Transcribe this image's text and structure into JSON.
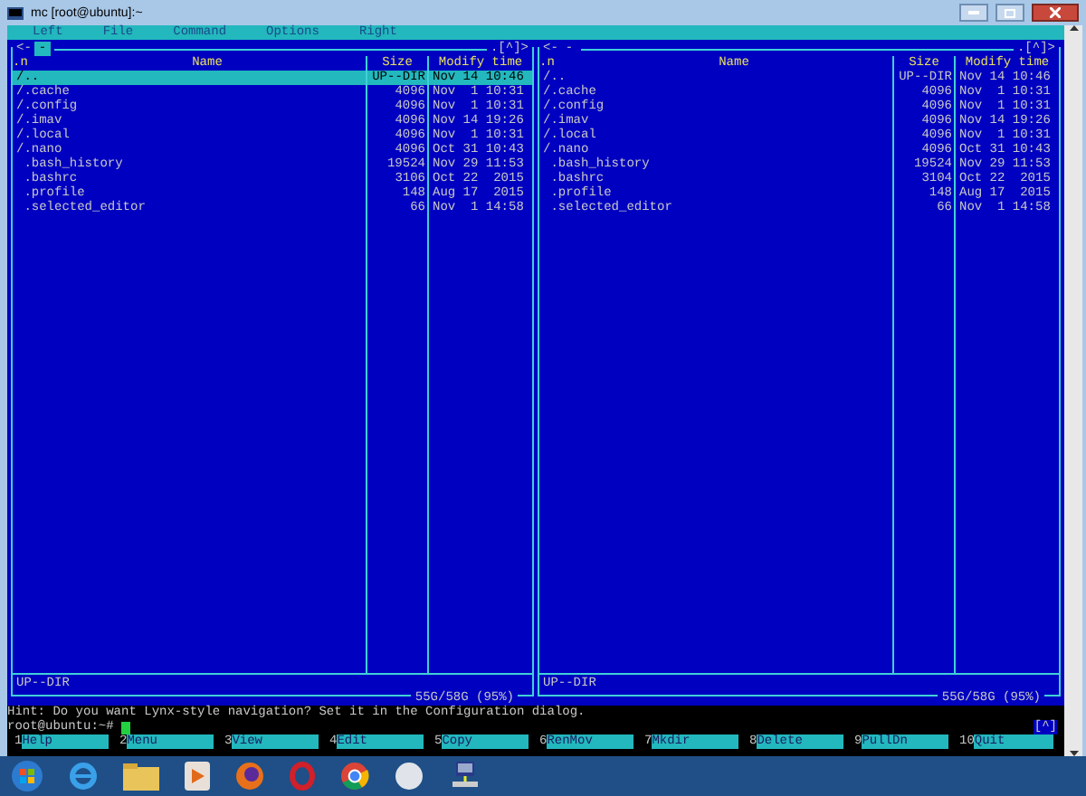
{
  "window": {
    "title": "mc [root@ubuntu]:~"
  },
  "menu_bar": [
    {
      "label": "Left"
    },
    {
      "label": "File"
    },
    {
      "label": "Command"
    },
    {
      "label": "Options"
    },
    {
      "label": "Right"
    }
  ],
  "panels": [
    {
      "active": true,
      "header_left": "<-",
      "header_mark": "-",
      "header_right": ".[^]>",
      "columns": [
        ".n",
        "Name",
        "Size",
        "Modify time"
      ],
      "rows": [
        {
          "name": "/..",
          "size": "UP--DIR",
          "modified": "Nov 14 10:46",
          "selected": true
        },
        {
          "name": "/.cache",
          "size": "4096",
          "modified": "Nov  1 10:31",
          "selected": false
        },
        {
          "name": "/.config",
          "size": "4096",
          "modified": "Nov  1 10:31",
          "selected": false
        },
        {
          "name": "/.imav",
          "size": "4096",
          "modified": "Nov 14 19:26",
          "selected": false
        },
        {
          "name": "/.local",
          "size": "4096",
          "modified": "Nov  1 10:31",
          "selected": false
        },
        {
          "name": "/.nano",
          "size": "4096",
          "modified": "Oct 31 10:43",
          "selected": false
        },
        {
          "name": " .bash_history",
          "size": "19524",
          "modified": "Nov 29 11:53",
          "selected": false
        },
        {
          "name": " .bashrc",
          "size": "3106",
          "modified": "Oct 22  2015",
          "selected": false
        },
        {
          "name": " .profile",
          "size": "148",
          "modified": "Aug 17  2015",
          "selected": false
        },
        {
          "name": " .selected_editor",
          "size": "66",
          "modified": "Nov  1 14:58",
          "selected": false
        }
      ],
      "status": "UP--DIR",
      "disk": "55G/58G (95%)"
    },
    {
      "active": false,
      "header_left": "<-",
      "header_mark": "-",
      "header_right": ".[^]>",
      "columns": [
        ".n",
        "Name",
        "Size",
        "Modify time"
      ],
      "rows": [
        {
          "name": "/..",
          "size": "UP--DIR",
          "modified": "Nov 14 10:46",
          "selected": false
        },
        {
          "name": "/.cache",
          "size": "4096",
          "modified": "Nov  1 10:31",
          "selected": false
        },
        {
          "name": "/.config",
          "size": "4096",
          "modified": "Nov  1 10:31",
          "selected": false
        },
        {
          "name": "/.imav",
          "size": "4096",
          "modified": "Nov 14 19:26",
          "selected": false
        },
        {
          "name": "/.local",
          "size": "4096",
          "modified": "Nov  1 10:31",
          "selected": false
        },
        {
          "name": "/.nano",
          "size": "4096",
          "modified": "Oct 31 10:43",
          "selected": false
        },
        {
          "name": " .bash_history",
          "size": "19524",
          "modified": "Nov 29 11:53",
          "selected": false
        },
        {
          "name": " .bashrc",
          "size": "3104",
          "modified": "Oct 22  2015",
          "selected": false
        },
        {
          "name": " .profile",
          "size": "148",
          "modified": "Aug 17  2015",
          "selected": false
        },
        {
          "name": " .selected_editor",
          "size": "66",
          "modified": "Nov  1 14:58",
          "selected": false
        }
      ],
      "status": "UP--DIR",
      "disk": "55G/58G (95%)"
    }
  ],
  "hint": "Hint: Do you want Lynx-style navigation? Set it in the Configuration dialog.",
  "prompt": "root@ubuntu:~#",
  "corner_mark": "[^]",
  "function_keys": [
    {
      "number": "1",
      "label": "Help"
    },
    {
      "number": "2",
      "label": "Menu"
    },
    {
      "number": "3",
      "label": "View"
    },
    {
      "number": "4",
      "label": "Edit"
    },
    {
      "number": "5",
      "label": "Copy"
    },
    {
      "number": "6",
      "label": "RenMov"
    },
    {
      "number": "7",
      "label": "Mkdir"
    },
    {
      "number": "8",
      "label": "Delete"
    },
    {
      "number": "9",
      "label": "PullDn"
    },
    {
      "number": "10",
      "label": "Quit"
    }
  ]
}
